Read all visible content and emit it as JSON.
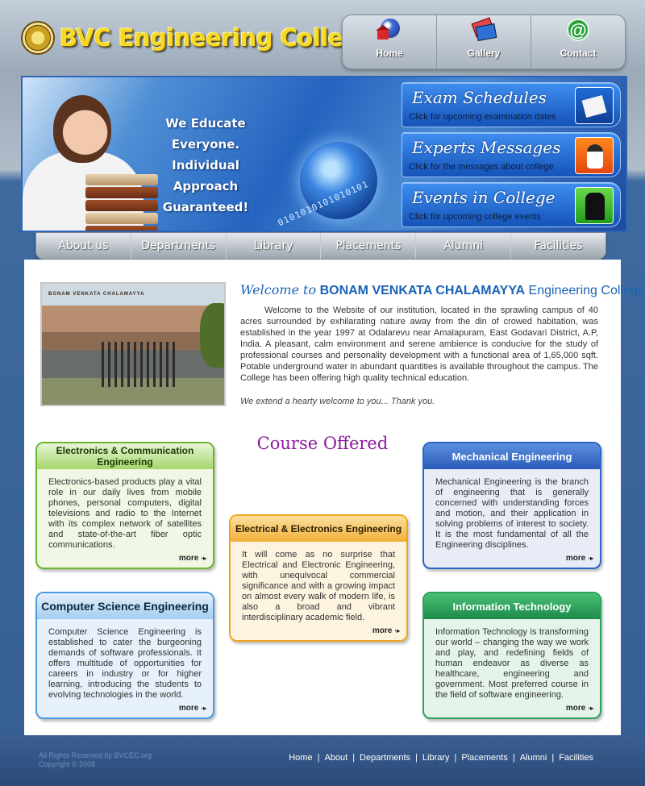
{
  "header": {
    "title": "BVC Engineering College",
    "top_nav": [
      {
        "label": "Home",
        "icon": "home-globe-icon"
      },
      {
        "label": "Gallery",
        "icon": "gallery-books-icon"
      },
      {
        "label": "Contact",
        "icon": "contact-at-icon"
      }
    ]
  },
  "banner": {
    "tagline": [
      "We Educate",
      "Everyone.",
      "Individual Approach",
      "Guaranteed!"
    ],
    "binary_text": "0101010101010101",
    "links": [
      {
        "title": "Exam Schedules",
        "subtitle": "Click for upcoming examination dates",
        "icon": "notepad-icon"
      },
      {
        "title": "Experts Messages",
        "subtitle": "Click for the messages about college",
        "icon": "expert-person-icon"
      },
      {
        "title": "Events in College",
        "subtitle": "Click for upcoming college events",
        "icon": "dancers-icon"
      }
    ]
  },
  "main_nav": [
    "About us",
    "Departments",
    "Library",
    "Placements",
    "Alumni",
    "Facilities"
  ],
  "welcome": {
    "photo_sign": "BONAM VENKATA CHALAMAYYA",
    "title_italic": "Welcome to",
    "title_bold": "BONAM VENKATA CHALAMAYYA",
    "title_rest": "Engineering College",
    "paragraph": "Welcome to the Website of our institution, located in the sprawling campus of 40 acres surrounded by exhilarating nature away from the din of crowed habitation, was established in the year 1997 at Odalarevu near Amalapuram, East Godavari District, A.P, India. A pleasant, calm environment and serene ambience is conducive for the study of professional courses and personality development with a functional area of 1,65,000 sqft. Potable underground water in abundant quantities is available throughout the campus. The College has been offering high quality technical education.",
    "thanks": "We extend a hearty welcome to you... Thank you."
  },
  "courses": {
    "heading": "Course Offered",
    "more_label": "more",
    "items": [
      {
        "title": "Electronics & Communication Engineering",
        "text": "Electronics-based products play a vital role in our daily lives from mobile phones, personal computers, digital televisions and radio to the Internet with its complex network of satellites and state-of-the-art fiber optic communications."
      },
      {
        "title": "Mechanical Engineering",
        "text": "Mechanical Engineering is the branch of engineering that is generally concerned with understanding forces and motion, and their application in solving problems of interest to society. It is the most fundamental of all the Engineering disciplines."
      },
      {
        "title": "Electrical & Electronics Engineering",
        "text": "It will come as no surprise that Electrical and Electronic Engineering, with unequivocal commercial significance and with a growing impact on almost every walk of modern life, is also a broad and vibrant interdisciplinary academic field."
      },
      {
        "title": "Computer Science Engineering",
        "text": "Computer Science Engineering is established to cater the burgeoning demands of software professionals. It offers multitude of opportunities for careers in industry or for higher learning, introducing the students to evolving technologies in the world."
      },
      {
        "title": "Information Technology",
        "text": "Information Technology is transforming our world – changing the way we work and play, and redefining fields of human endeavor as diverse as healthcare, engineering and government. Most preferred course in the field of software engineering."
      }
    ]
  },
  "footer": {
    "rights": "All Rights Reserved by BVCEC.org",
    "copyright": "Copyright © 2008",
    "links": [
      "Home",
      "About",
      "Departments",
      "Library",
      "Placements",
      "Alumni",
      "Facilities"
    ],
    "separator": "|"
  }
}
